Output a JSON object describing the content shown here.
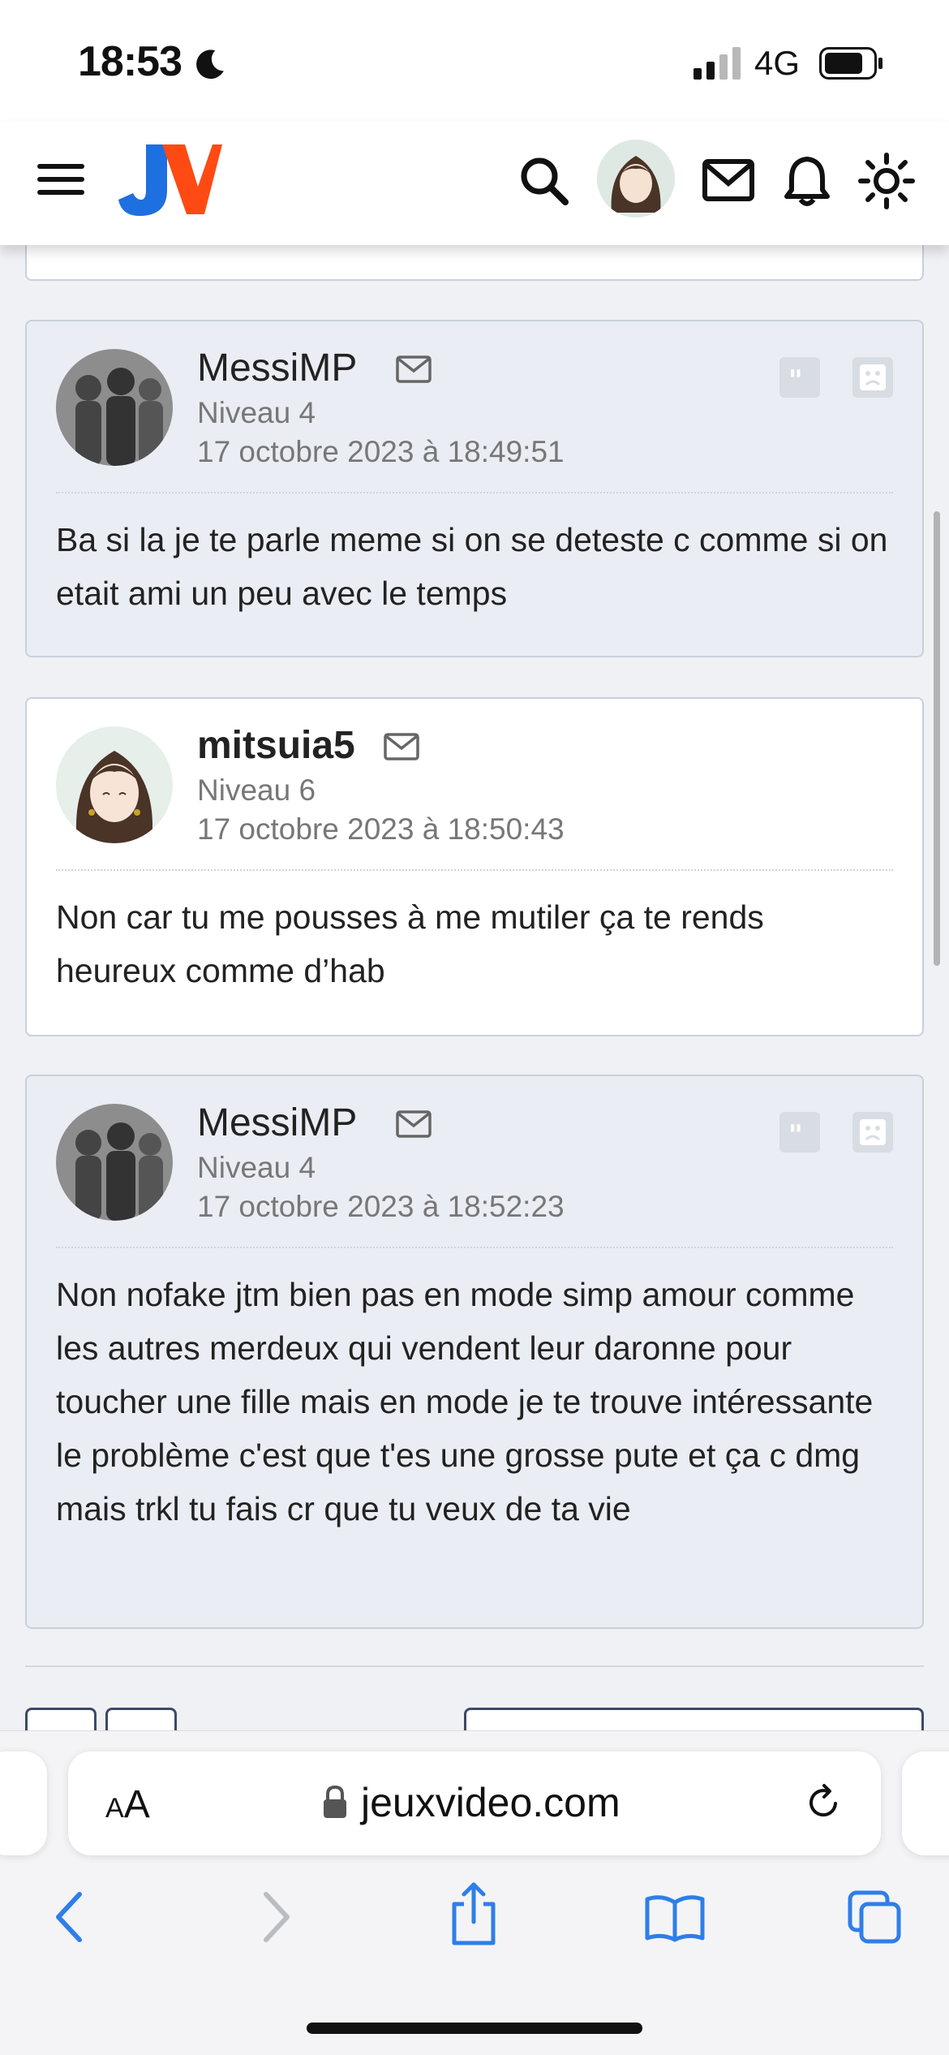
{
  "status_bar": {
    "time": "18:53",
    "network": "4G"
  },
  "header": {
    "logo": "JV",
    "icons": [
      "menu-icon",
      "search-icon",
      "avatar",
      "mail-icon",
      "bell-icon",
      "sun-icon"
    ]
  },
  "posts": [
    {
      "author": "MessiMP",
      "level": "Niveau 4",
      "date": "17 octobre 2023 à 18:49:51",
      "message": "Ba si la je te parle meme si on se deteste c comme si on etait ami un peu avec le temps"
    },
    {
      "author": "mitsuia5",
      "level": "Niveau 6",
      "date": "17 octobre 2023 à 18:50:43",
      "message": "Non car tu me pousses à me mutiler ça te rends heureux comme d’hab"
    },
    {
      "author": "MessiMP",
      "level": "Niveau 4",
      "date": "17 octobre 2023 à 18:52:23",
      "message": "Non nofake jtm bien pas en mode simp amour comme les autres merdeux qui vendent leur daronne pour toucher une fille mais en mode je te trouve intéressante le problème c'est que t'es une grosse pute et ça c dmg mais trkl tu fais cr que tu veux de ta vie"
    }
  ],
  "browser": {
    "text_size_label_small": "A",
    "text_size_label_large": "A",
    "domain": "jeuxvideo.com"
  },
  "colors": {
    "accent_blue": "#1a73e8",
    "logo_blue": "#1e6fe0",
    "logo_orange": "#ff4a13",
    "ios_blue": "#2f7ee8"
  }
}
